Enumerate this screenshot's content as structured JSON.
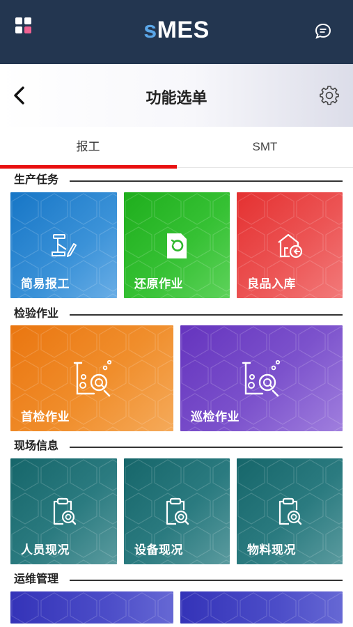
{
  "app": {
    "brand_prefix": "s",
    "brand_rest": "MES"
  },
  "header": {
    "title": "功能选单"
  },
  "tabs": [
    {
      "label": "报工",
      "active": true
    },
    {
      "label": "SMT",
      "active": false
    }
  ],
  "sections": [
    {
      "label": "生产任务",
      "tiles": [
        {
          "label": "简易报工",
          "icon": "robot-arm-icon",
          "color": "#1776c6"
        },
        {
          "label": "还原作业",
          "icon": "restore-document-icon",
          "color": "#1fae1d"
        },
        {
          "label": "良品入库",
          "icon": "warehouse-in-icon",
          "color": "#e43131"
        }
      ]
    },
    {
      "label": "检验作业",
      "tiles": [
        {
          "label": "首检作业",
          "icon": "lab-inspect-icon",
          "color": "#ea7610"
        },
        {
          "label": "巡检作业",
          "icon": "lab-inspect-icon",
          "color": "#6534be"
        }
      ]
    },
    {
      "label": "现场信息",
      "tiles": [
        {
          "label": "人员现况",
          "icon": "clipboard-search-icon",
          "color": "#16666a"
        },
        {
          "label": "设备现况",
          "icon": "clipboard-search-icon",
          "color": "#16666a"
        },
        {
          "label": "物料现况",
          "icon": "clipboard-search-icon",
          "color": "#16666a"
        }
      ]
    },
    {
      "label": "运维管理",
      "tiles": [
        {
          "label": "",
          "color": "#3433b8"
        },
        {
          "label": "",
          "color": "#3433b8"
        }
      ]
    }
  ],
  "colors": {
    "appbar": "#233650",
    "tab_indicator": "#e81010",
    "brand_accent": "#5aa6e8"
  }
}
